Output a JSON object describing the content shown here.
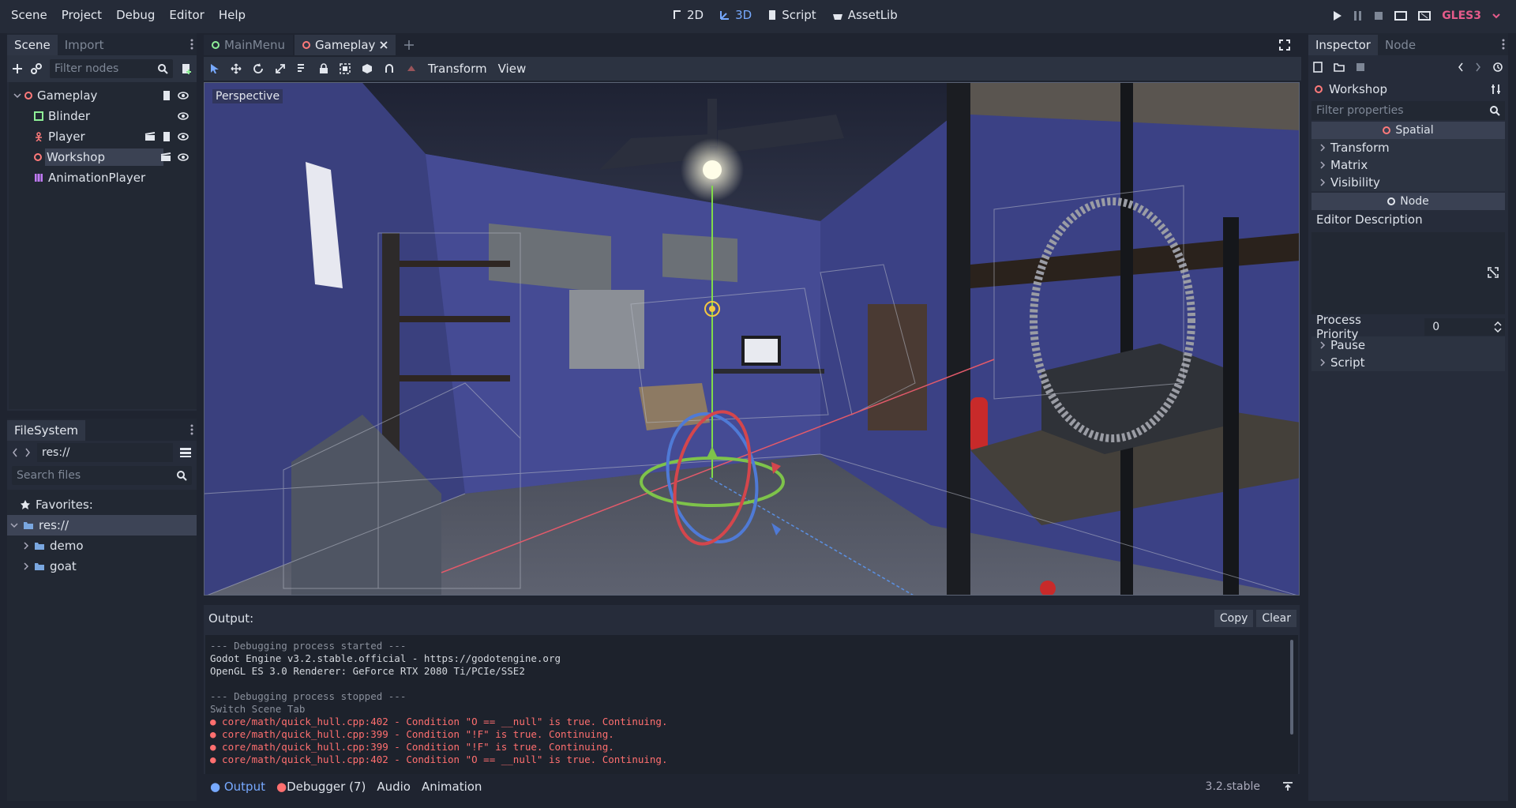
{
  "menu": [
    "Scene",
    "Project",
    "Debug",
    "Editor",
    "Help"
  ],
  "main_screens": [
    {
      "label": "2D",
      "active": false
    },
    {
      "label": "3D",
      "active": true
    },
    {
      "label": "Script",
      "active": false
    },
    {
      "label": "AssetLib",
      "active": false
    }
  ],
  "renderer": "GLES3",
  "scene_dock": {
    "tabs": [
      "Scene",
      "Import"
    ],
    "filter_placeholder": "Filter nodes",
    "nodes": [
      {
        "label": "Gameplay",
        "icon": "spatial-icon"
      },
      {
        "label": "Blinder",
        "icon": "color-rect-icon"
      },
      {
        "label": "Player",
        "icon": "kinematic-icon"
      },
      {
        "label": "Workshop",
        "icon": "spatial-icon"
      },
      {
        "label": "AnimationPlayer",
        "icon": "animation-player-icon"
      }
    ]
  },
  "filesystem": {
    "tab": "FileSystem",
    "path": "res://",
    "search_placeholder": "Search files",
    "favorites": "Favorites:",
    "root": "res://",
    "folders": [
      "demo",
      "goat"
    ]
  },
  "editor_tabs": [
    {
      "label": "MainMenu",
      "active": false
    },
    {
      "label": "Gameplay",
      "active": true
    }
  ],
  "toolbar3d": {
    "transform": "Transform",
    "view": "View"
  },
  "viewport": {
    "label": "Perspective"
  },
  "output": {
    "title": "Output:",
    "copy": "Copy",
    "clear": "Clear",
    "lines": [
      {
        "text": "--- Debugging process started ---",
        "kind": "dim"
      },
      {
        "text": "Godot Engine v3.2.stable.official - https://godotengine.org",
        "kind": "normal"
      },
      {
        "text": "OpenGL ES 3.0 Renderer: GeForce RTX 2080 Ti/PCIe/SSE2",
        "kind": "normal"
      },
      {
        "text": "",
        "kind": "normal"
      },
      {
        "text": "--- Debugging process stopped ---",
        "kind": "dim"
      },
      {
        "text": "Switch Scene Tab",
        "kind": "dim"
      },
      {
        "text": "● core/math/quick_hull.cpp:402 - Condition \"O == __null\" is true. Continuing.",
        "kind": "err"
      },
      {
        "text": "● core/math/quick_hull.cpp:399 - Condition \"!F\" is true. Continuing.",
        "kind": "err"
      },
      {
        "text": "● core/math/quick_hull.cpp:399 - Condition \"!F\" is true. Continuing.",
        "kind": "err"
      },
      {
        "text": "● core/math/quick_hull.cpp:402 - Condition \"O == __null\" is true. Continuing.",
        "kind": "err"
      }
    ]
  },
  "bottom_tabs": {
    "output": "Output",
    "debugger": "Debugger (7)",
    "audio": "Audio",
    "animation": "Animation",
    "version": "3.2.stable"
  },
  "inspector": {
    "tabs": [
      "Inspector",
      "Node"
    ],
    "object": "Workshop",
    "filter_placeholder": "Filter properties",
    "spatial": "Spatial",
    "spatial_props": [
      "Transform",
      "Matrix",
      "Visibility"
    ],
    "node": "Node",
    "editor_description": "Editor Description",
    "process_priority_label": "Process Priority",
    "process_priority_value": "0",
    "node_props": [
      "Pause",
      "Script"
    ]
  }
}
